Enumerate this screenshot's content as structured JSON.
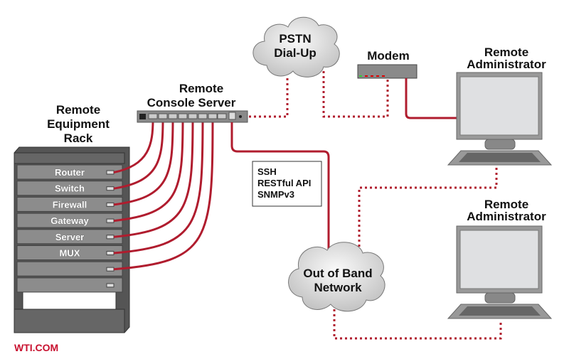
{
  "rack": {
    "title": [
      "Remote",
      "Equipment",
      "Rack"
    ],
    "units": [
      "Router",
      "Switch",
      "Firewall",
      "Gateway",
      "Server",
      "MUX",
      "",
      ""
    ]
  },
  "console_server": {
    "title": [
      "Remote",
      "Console Server"
    ]
  },
  "pstn": {
    "label": [
      "PSTN",
      "Dial-Up"
    ]
  },
  "modem": {
    "label": "Modem"
  },
  "admin_top": {
    "label": [
      "Remote",
      "Administrator"
    ]
  },
  "admin_bottom": {
    "label": [
      "Remote",
      "Administrator"
    ]
  },
  "protocols": [
    "SSH",
    "RESTful API",
    "SNMPv3"
  ],
  "oob": {
    "label": [
      "Out of Band",
      "Network"
    ]
  },
  "brand": {
    "text": "WTI.COM"
  },
  "colors": {
    "cable": "#b01c2e",
    "brand": "#c8102e",
    "device": "#8a8a8a"
  }
}
